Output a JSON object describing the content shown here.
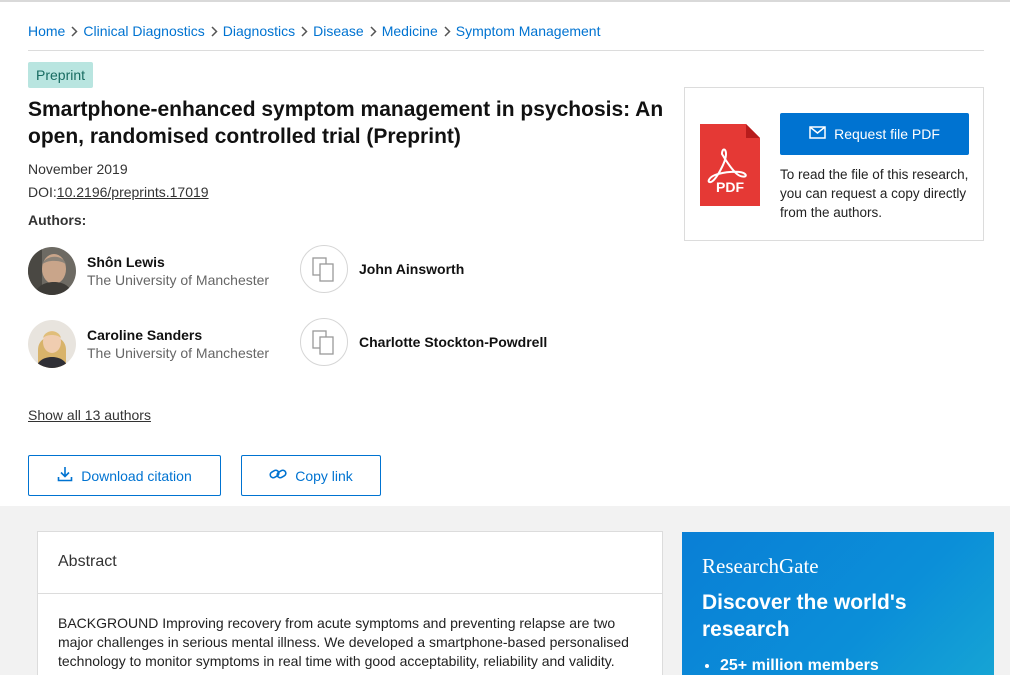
{
  "breadcrumb": [
    "Home",
    "Clinical Diagnostics",
    "Diagnostics",
    "Disease",
    "Medicine",
    "Symptom Management"
  ],
  "badge": "Preprint",
  "title": "Smartphone-enhanced symptom management in psychosis: An open, randomised controlled trial (Preprint)",
  "date": "November 2019",
  "doi": {
    "prefix": "DOI:",
    "value": "10.2196/preprints.17019"
  },
  "authors_heading": "Authors:",
  "authors": [
    {
      "name": "Shôn Lewis",
      "affiliation": "The University of Manchester"
    },
    {
      "name": "John Ainsworth",
      "affiliation": ""
    },
    {
      "name": "Caroline Sanders",
      "affiliation": "The University of Manchester"
    },
    {
      "name": "Charlotte Stockton-Powdrell",
      "affiliation": ""
    }
  ],
  "show_all": "Show all 13 authors",
  "buttons": {
    "download_citation": "Download citation",
    "copy_link": "Copy link"
  },
  "request_card": {
    "button": "Request file PDF",
    "pdf_label": "PDF",
    "text": "To read the file of this research, you can request a copy directly from the authors."
  },
  "abstract": {
    "heading": "Abstract",
    "body": "BACKGROUND Improving recovery from acute symptoms and preventing relapse are two major challenges in serious mental illness. We developed a smartphone-based personalised technology to monitor symptoms in real time with good acceptability, reliability and validity. OBJECTIVE To assess (i) acceptability of continuous monitoring to SMI patients and health"
  },
  "promo": {
    "logo": "ResearchGate",
    "heading": "Discover the world's research",
    "items": [
      "25+ million members"
    ]
  },
  "colors": {
    "accent": "#0073d1",
    "badge_bg": "#b9e5e0",
    "pdf_red": "#e53935"
  }
}
